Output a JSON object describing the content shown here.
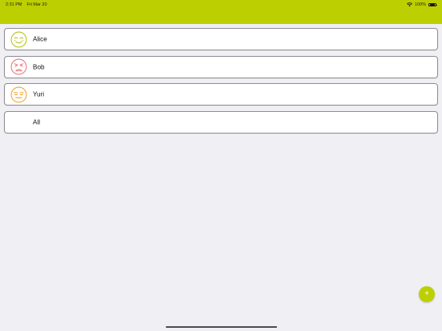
{
  "status_bar": {
    "time": "2:31 PM",
    "date": "Fri Mar 20",
    "battery": "100%"
  },
  "people": [
    {
      "name": "Alice",
      "mood": "smiling-face-icon",
      "color": "#b5c21a"
    },
    {
      "name": "Bob",
      "mood": "angry-face-icon",
      "color": "#e8757b"
    },
    {
      "name": "Yuri",
      "mood": "expressionless-face-icon",
      "color": "#f0a32a"
    }
  ],
  "all_row": {
    "label": "All"
  },
  "fab": {
    "label": "+"
  },
  "colors": {
    "accent": "#bccf00",
    "background": "#efeff4"
  }
}
